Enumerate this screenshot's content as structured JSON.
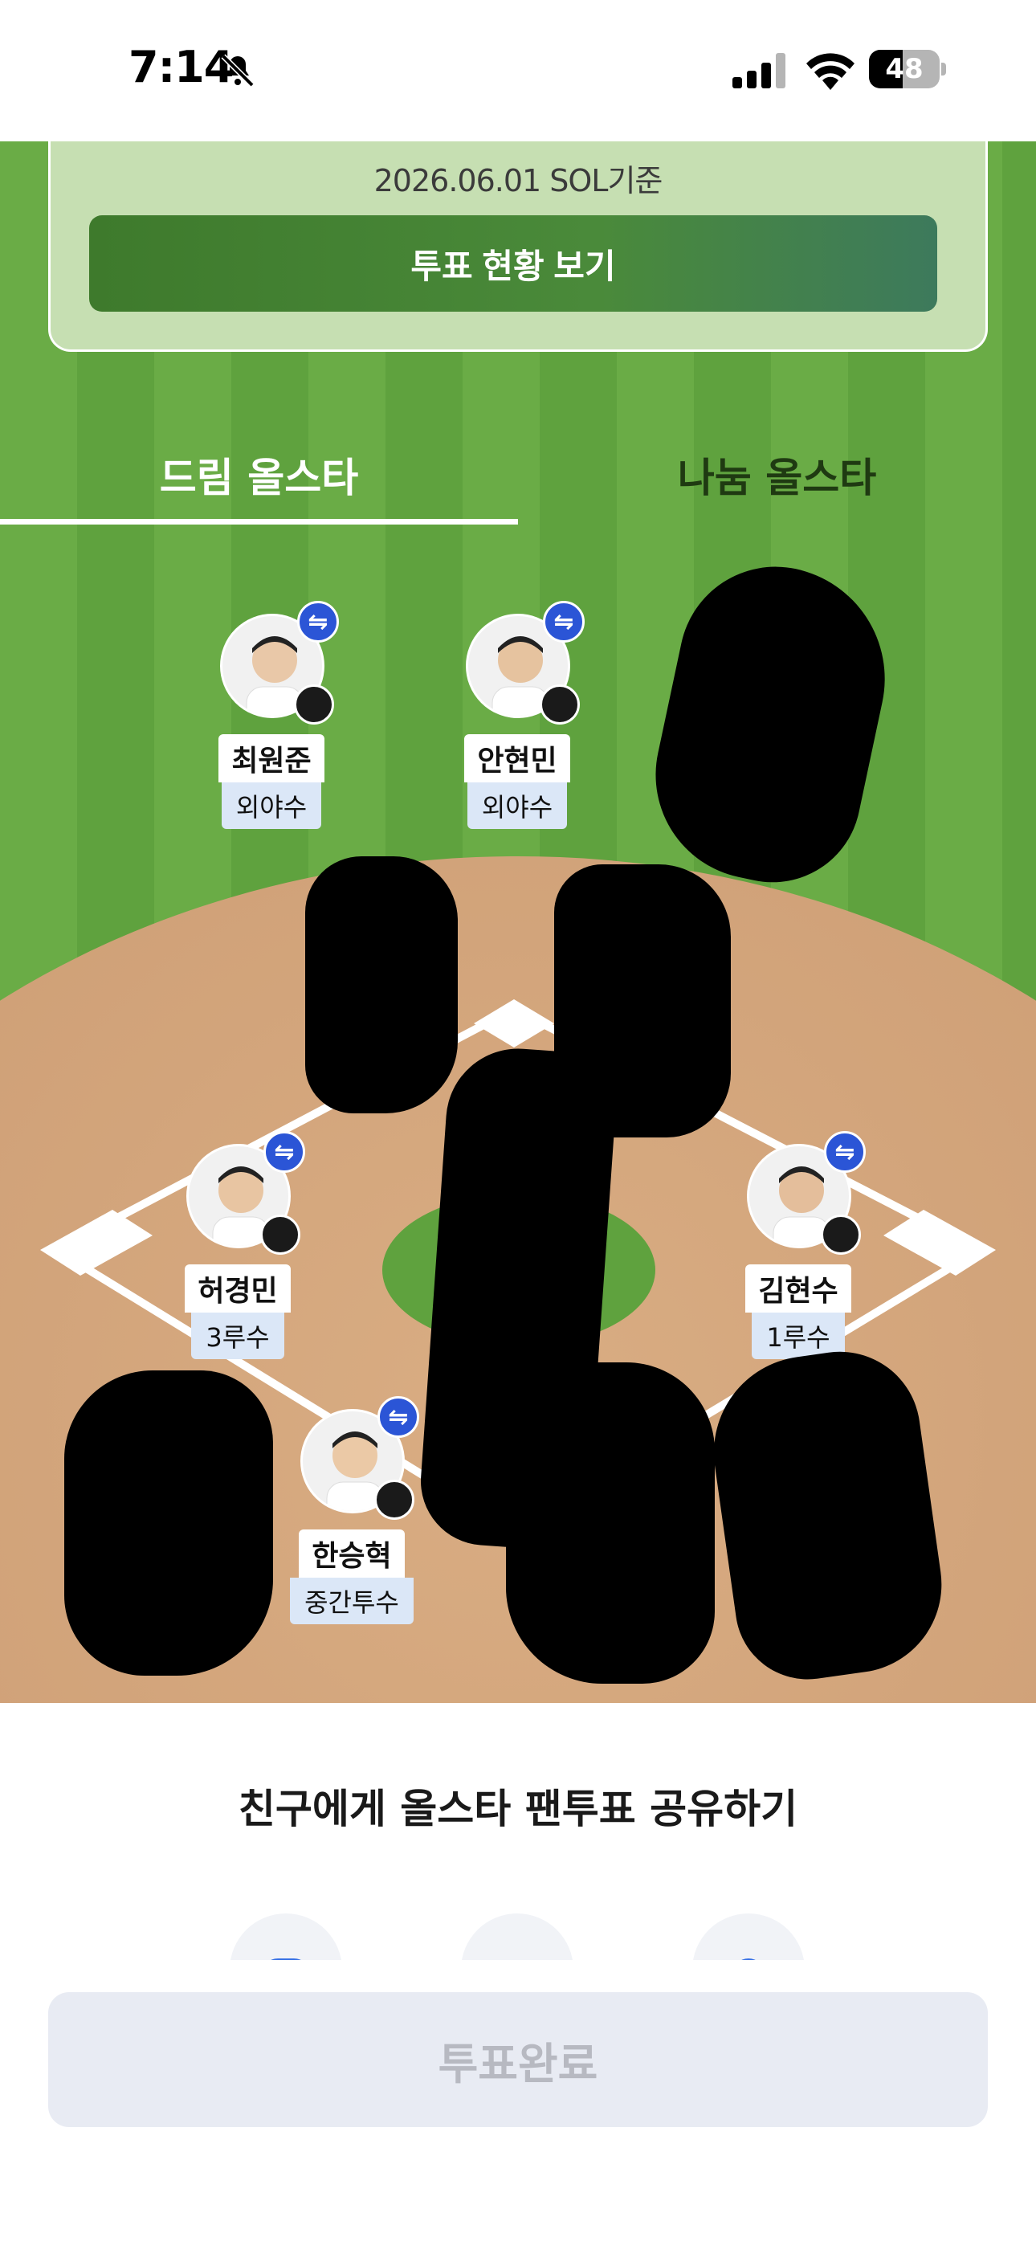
{
  "status_bar": {
    "time": "7:14",
    "battery": "48",
    "battery_level": 0.48
  },
  "info_card": {
    "date_text": "2026.06.01 SOL기준",
    "button_label": "투표 현황 보기"
  },
  "tabs": [
    {
      "label": "드림 올스타",
      "active": true
    },
    {
      "label": "나눔 올스타",
      "active": false
    }
  ],
  "players": [
    {
      "name": "최원준",
      "position": "외야수"
    },
    {
      "name": "안현민",
      "position": "외야수"
    },
    {
      "name": "허경민",
      "position": "3루수"
    },
    {
      "name": "김현수",
      "position": "1루수"
    },
    {
      "name": "한승혁",
      "position": "중간투수"
    }
  ],
  "share": {
    "title": "친구에게 올스타 팬투표 공유하기"
  },
  "bottom_button": {
    "label": "투표완료"
  },
  "colors": {
    "grass": "#6aac46",
    "dirt": "#cfa077",
    "swap_badge": "#2b55d6",
    "info_button": "#3e7a2c"
  },
  "icons": {
    "swap": "swap-arrows-icon",
    "bell": "bell-slash-icon",
    "signal": "cellular-signal-icon",
    "wifi": "wifi-icon"
  }
}
